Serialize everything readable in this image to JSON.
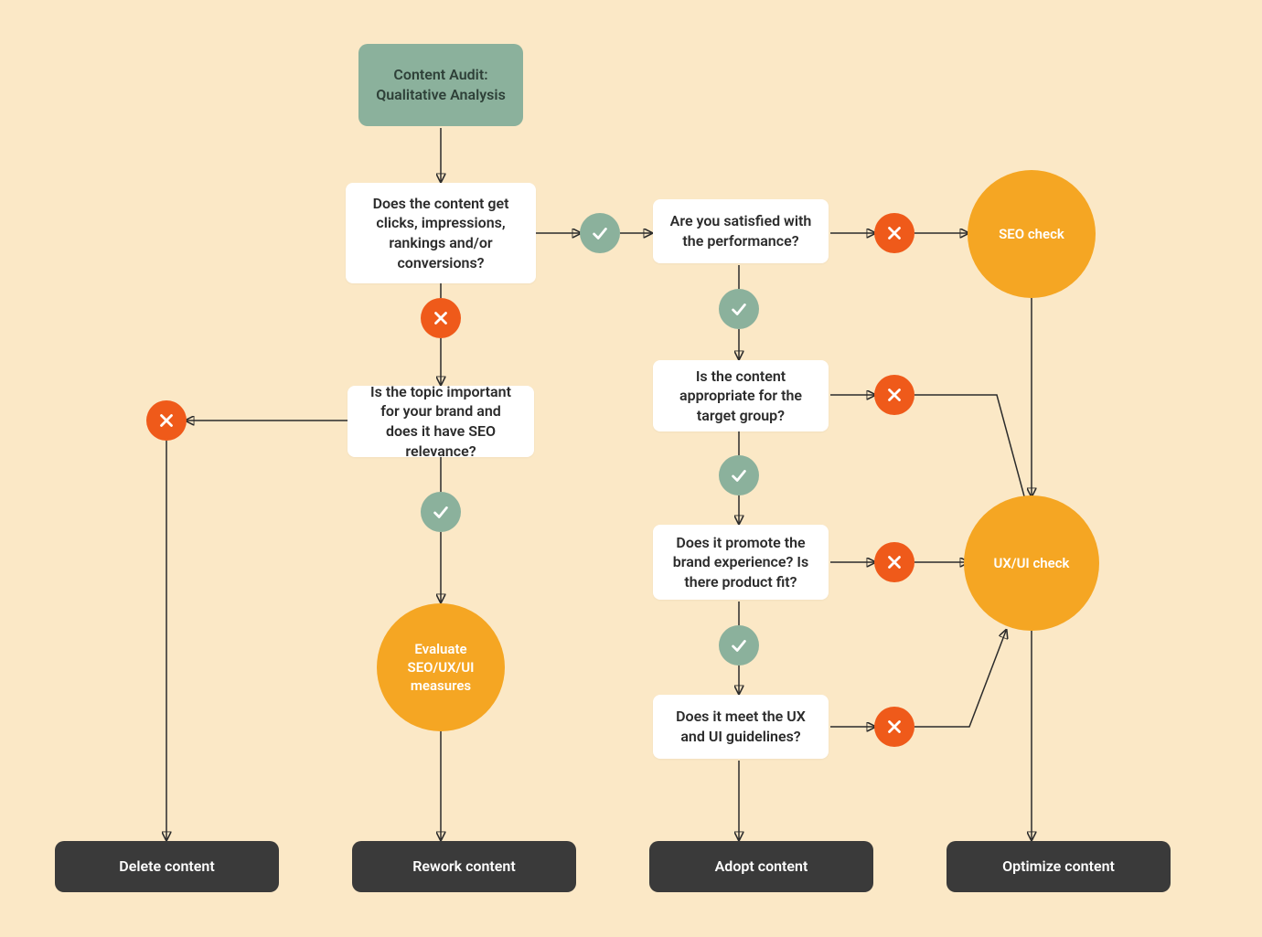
{
  "start": {
    "title": "Content Audit: Qualitative Analysis"
  },
  "q1": {
    "text": "Does the content get clicks, impressions, rankings and/or conversions?"
  },
  "q2": {
    "text": "Is the topic important for your brand and does it have SEO relevance?"
  },
  "q3": {
    "text": "Are you satisfied with the performance?"
  },
  "q4": {
    "text": "Is the content appropriate for the target group?"
  },
  "q5": {
    "text": "Does it promote the brand experience? Is there product fit?"
  },
  "q6": {
    "text": "Does it meet the UX and UI guidelines?"
  },
  "eval": {
    "text": "Evaluate SEO/UX/UI measures"
  },
  "seo": {
    "text": "SEO check"
  },
  "uxui": {
    "text": "UX/UI check"
  },
  "outcomes": {
    "delete": "Delete content",
    "rework": "Rework content",
    "adopt": "Adopt content",
    "optimize": "Optimize content"
  },
  "chart_data": {
    "type": "flowchart",
    "title": "Content Audit: Qualitative Analysis",
    "nodes": [
      {
        "id": "start",
        "kind": "start",
        "label": "Content Audit: Qualitative Analysis"
      },
      {
        "id": "q1",
        "kind": "decision",
        "label": "Does the content get clicks, impressions, rankings and/or conversions?"
      },
      {
        "id": "q2",
        "kind": "decision",
        "label": "Is the topic important for your brand and does it have SEO relevance?"
      },
      {
        "id": "q3",
        "kind": "decision",
        "label": "Are you satisfied with the performance?"
      },
      {
        "id": "q4",
        "kind": "decision",
        "label": "Is the content appropriate for the target group?"
      },
      {
        "id": "q5",
        "kind": "decision",
        "label": "Does it promote the brand experience? Is there product fit?"
      },
      {
        "id": "q6",
        "kind": "decision",
        "label": "Does it meet the UX and UI guidelines?"
      },
      {
        "id": "eval",
        "kind": "process",
        "label": "Evaluate SEO/UX/UI measures"
      },
      {
        "id": "seo",
        "kind": "process",
        "label": "SEO check"
      },
      {
        "id": "uxui",
        "kind": "process",
        "label": "UX/UI check"
      },
      {
        "id": "delete",
        "kind": "terminal",
        "label": "Delete content"
      },
      {
        "id": "rework",
        "kind": "terminal",
        "label": "Rework content"
      },
      {
        "id": "adopt",
        "kind": "terminal",
        "label": "Adopt content"
      },
      {
        "id": "optimize",
        "kind": "terminal",
        "label": "Optimize content"
      }
    ],
    "edges": [
      {
        "from": "start",
        "to": "q1",
        "label": null
      },
      {
        "from": "q1",
        "to": "q3",
        "label": "yes"
      },
      {
        "from": "q1",
        "to": "q2",
        "label": "no"
      },
      {
        "from": "q2",
        "to": "delete",
        "label": "no"
      },
      {
        "from": "q2",
        "to": "eval",
        "label": "yes"
      },
      {
        "from": "eval",
        "to": "rework",
        "label": null
      },
      {
        "from": "q3",
        "to": "seo",
        "label": "no"
      },
      {
        "from": "q3",
        "to": "q4",
        "label": "yes"
      },
      {
        "from": "q4",
        "to": "uxui",
        "label": "no"
      },
      {
        "from": "q4",
        "to": "q5",
        "label": "yes"
      },
      {
        "from": "q5",
        "to": "uxui",
        "label": "no"
      },
      {
        "from": "q5",
        "to": "q6",
        "label": "yes"
      },
      {
        "from": "q6",
        "to": "uxui",
        "label": "no"
      },
      {
        "from": "q6",
        "to": "adopt",
        "label": null
      },
      {
        "from": "seo",
        "to": "uxui",
        "label": null
      },
      {
        "from": "uxui",
        "to": "optimize",
        "label": null
      }
    ]
  }
}
